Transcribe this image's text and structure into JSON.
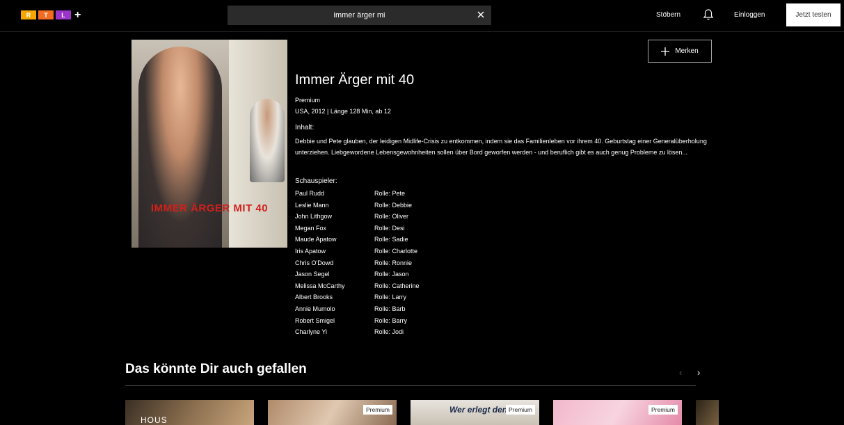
{
  "header": {
    "logo_letters": [
      "R",
      "T",
      "L"
    ],
    "logo_colors": [
      "#f7a600",
      "#f36c21",
      "#9b35c9"
    ],
    "logo_plus": "+",
    "search_value": "immer ärger mi",
    "nav_browse": "Stöbern",
    "nav_login": "Einloggen",
    "cta_label": "Jetzt testen"
  },
  "detail": {
    "poster_title": "IMMER ÄRGER MIT 40",
    "title": "Immer Ärger mit 40",
    "tier": "Premium",
    "info": "USA, 2012 | Länge 128 Min, ab 12",
    "content_heading": "Inhalt:",
    "description": "Debbie und Pete glauben, der leidigen Midlife-Crisis zu entkommen, indem sie das Familienleben vor ihrem 40. Geburtstag einer Generalüberholung unterziehen. Liebgewordene Lebensgewohnheiten sollen über Bord geworfen werden - und beruflich gibt es auch genug Probleme zu lösen...",
    "cast_heading": "Schauspieler:",
    "merken_label": "Merken",
    "cast": [
      {
        "actor": "Paul Rudd",
        "role": "Rolle: Pete"
      },
      {
        "actor": "Leslie Mann",
        "role": "Rolle: Debbie"
      },
      {
        "actor": "John Lithgow",
        "role": "Rolle: Oliver"
      },
      {
        "actor": "Megan Fox",
        "role": "Rolle: Desi"
      },
      {
        "actor": "Maude Apatow",
        "role": "Rolle: Sadie"
      },
      {
        "actor": "Iris Apatow",
        "role": "Rolle: Charlotte"
      },
      {
        "actor": "Chris O'Dowd",
        "role": "Rolle: Ronnie"
      },
      {
        "actor": "Jason Segel",
        "role": "Rolle: Jason"
      },
      {
        "actor": "Melissa McCarthy",
        "role": "Rolle: Catherine"
      },
      {
        "actor": "Albert Brooks",
        "role": "Rolle: Larry"
      },
      {
        "actor": "Annie Mumolo",
        "role": "Rolle: Barb"
      },
      {
        "actor": "Robert Smigel",
        "role": "Rolle: Barry"
      },
      {
        "actor": "Charlyne Yi",
        "role": "Rolle: Jodi"
      }
    ]
  },
  "recommendations": {
    "title": "Das könnte Dir auch gefallen",
    "prev_arrow": "‹",
    "next_arrow": "›",
    "tiles": [
      {
        "art_text": "HOUS",
        "badge": ""
      },
      {
        "art_text": "",
        "badge": "Premium"
      },
      {
        "art_text": "Wer erlegt den Dachs",
        "badge": "Premium"
      },
      {
        "art_text": "",
        "badge": "Premium"
      }
    ]
  }
}
